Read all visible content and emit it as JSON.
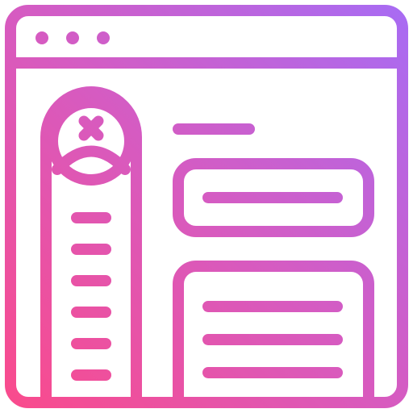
{
  "icon": {
    "name": "browser-window-profile-icon",
    "window_controls": 3,
    "sidebar_list_items": 6,
    "content_panels": 2,
    "panel_text_lines": [
      1,
      3
    ],
    "colors": {
      "gradient_start": "#fb4a8a",
      "gradient_mid": "#d65bc1",
      "gradient_end": "#a66cf5"
    }
  }
}
